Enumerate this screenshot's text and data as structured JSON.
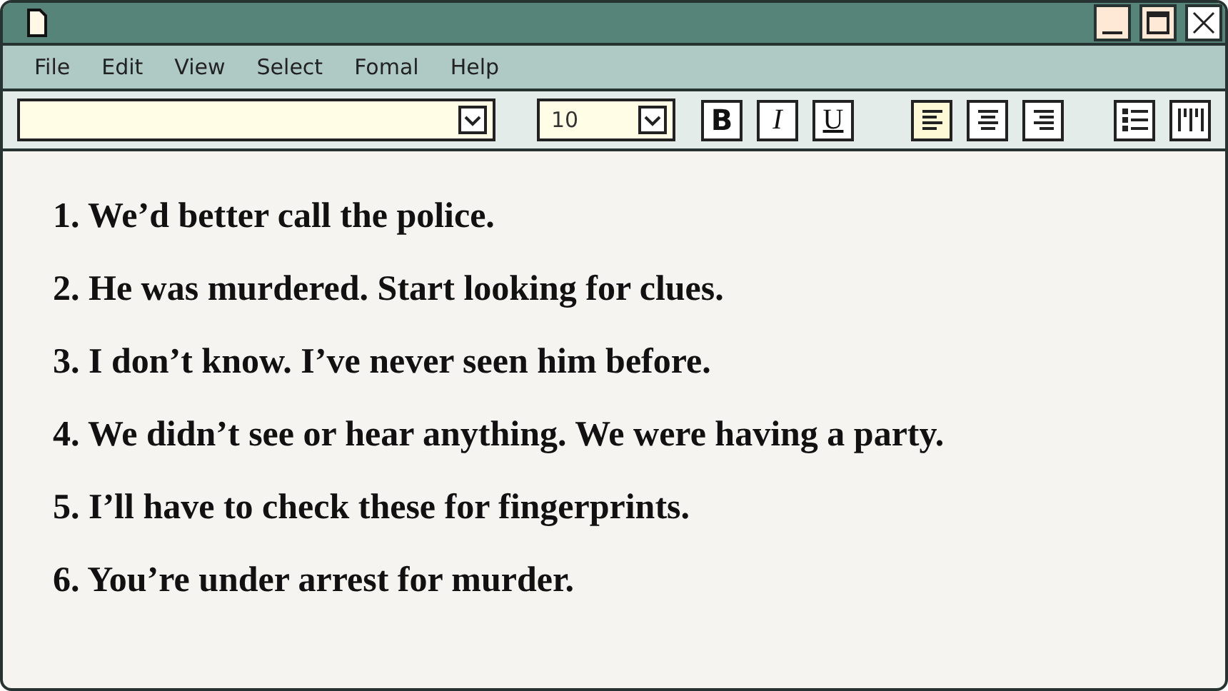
{
  "menu": [
    "File",
    "Edit",
    "View",
    "Select",
    "Fomal",
    "Help"
  ],
  "toolbar": {
    "size_field": {
      "value": "10"
    },
    "format_buttons": [
      {
        "kind": "bold",
        "label": "B",
        "selected": false
      },
      {
        "kind": "italic",
        "label": "I",
        "selected": false
      },
      {
        "kind": "underline",
        "label": "U",
        "selected": false
      }
    ],
    "align_buttons": [
      {
        "kind": "left",
        "selected": true
      },
      {
        "kind": "center",
        "selected": false
      },
      {
        "kind": "right",
        "selected": false
      }
    ],
    "list_buttons": [
      {
        "kind": "bullets"
      },
      {
        "kind": "columns"
      }
    ]
  },
  "document": {
    "lines": [
      "1. We’d better call the police.",
      "2. He was murdered. Start looking for clues.",
      "3. I don’t know. I’ve never seen him before.",
      "4. We didn’t see or hear anything. We were having a party.",
      "5. I’ll have to check these for fingerprints.",
      "6. You’re under arrest for murder."
    ]
  }
}
